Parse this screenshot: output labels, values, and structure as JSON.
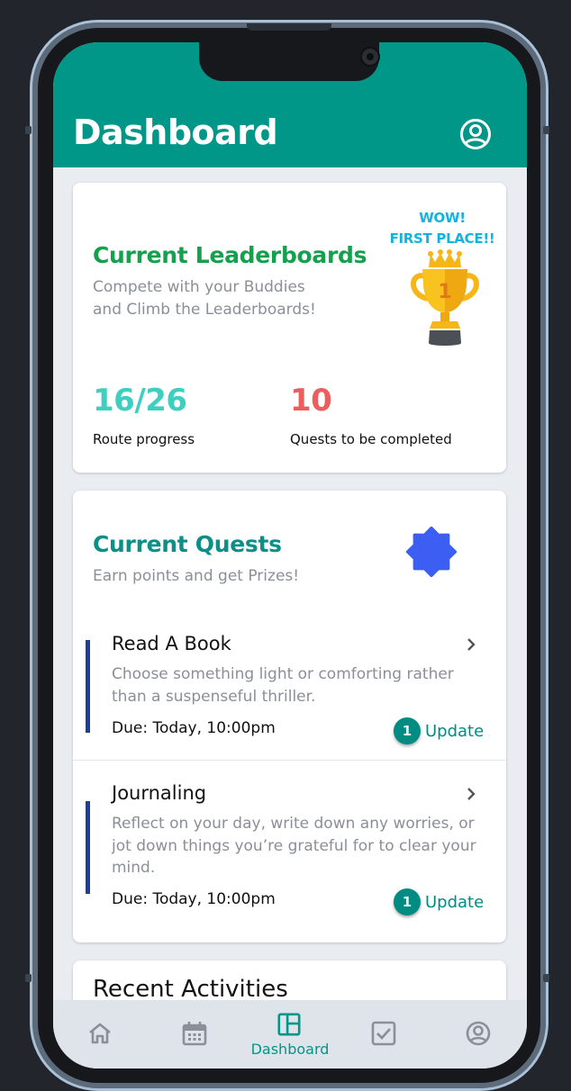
{
  "header": {
    "title": "Dashboard",
    "profile_icon": "account-circle-icon"
  },
  "leaderboard_card": {
    "title": "Current Leaderboards",
    "subtitle_line1": "Compete with your Buddies",
    "subtitle_line2": "and Climb the Leaderboards!",
    "trophy_text_line1": "WOW!",
    "trophy_text_line2": "FIRST PLACE!!",
    "trophy_rank": "1",
    "stats": [
      {
        "value": "16/26",
        "label": "Route progress",
        "color": "#3fcfc0"
      },
      {
        "value": "10",
        "label": "Quests to be completed",
        "color": "#ec5d5d"
      }
    ]
  },
  "quests_card": {
    "title": "Current Quests",
    "subtitle": "Earn points and get Prizes!",
    "badge_icon": "badge-icon",
    "badge_color": "#3c5ef2",
    "quests": [
      {
        "title": "Read A Book",
        "description": "Choose something light or comforting rather than a suspenseful thriller.",
        "due": "Due: Today, 10:00pm",
        "update_count": "1",
        "update_label": "Update"
      },
      {
        "title": "Journaling",
        "description": "Reflect on your day, write down any worries, or jot down things you’re grateful for to clear your mind.",
        "due": "Due: Today, 10:00pm",
        "update_count": "1",
        "update_label": "Update"
      }
    ]
  },
  "recent_card": {
    "title": "Recent Activities"
  },
  "bottom_nav": {
    "items": [
      {
        "icon": "home-icon",
        "label": ""
      },
      {
        "icon": "calendar-icon",
        "label": ""
      },
      {
        "icon": "dashboard-icon",
        "label": "Dashboard",
        "active": true
      },
      {
        "icon": "checkbox-icon",
        "label": ""
      },
      {
        "icon": "account-circle-icon",
        "label": ""
      }
    ]
  },
  "colors": {
    "primary": "#009688",
    "title_green": "#14a04c",
    "quest_title": "#0b8f86",
    "nav_inactive": "#8a9097"
  }
}
